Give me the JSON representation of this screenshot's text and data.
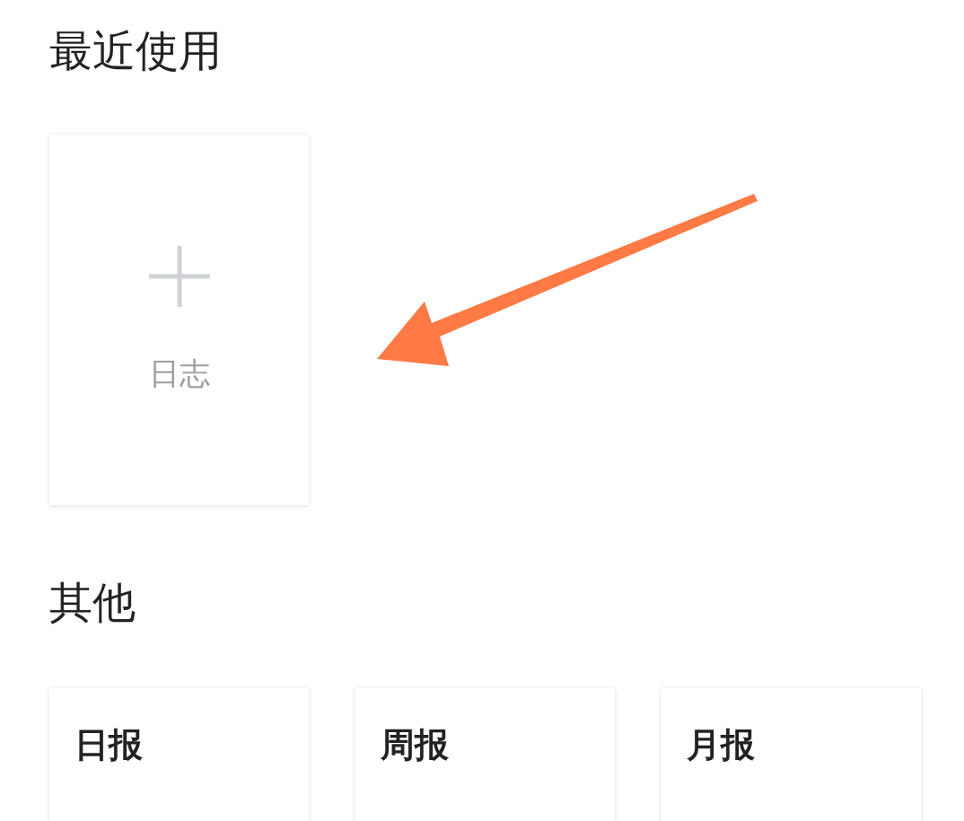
{
  "recent": {
    "title": "最近使用",
    "items": [
      {
        "label": "日志"
      }
    ]
  },
  "other": {
    "title": "其他",
    "items": [
      {
        "title": "日报"
      },
      {
        "title": "周报"
      },
      {
        "title": "月报"
      }
    ]
  }
}
